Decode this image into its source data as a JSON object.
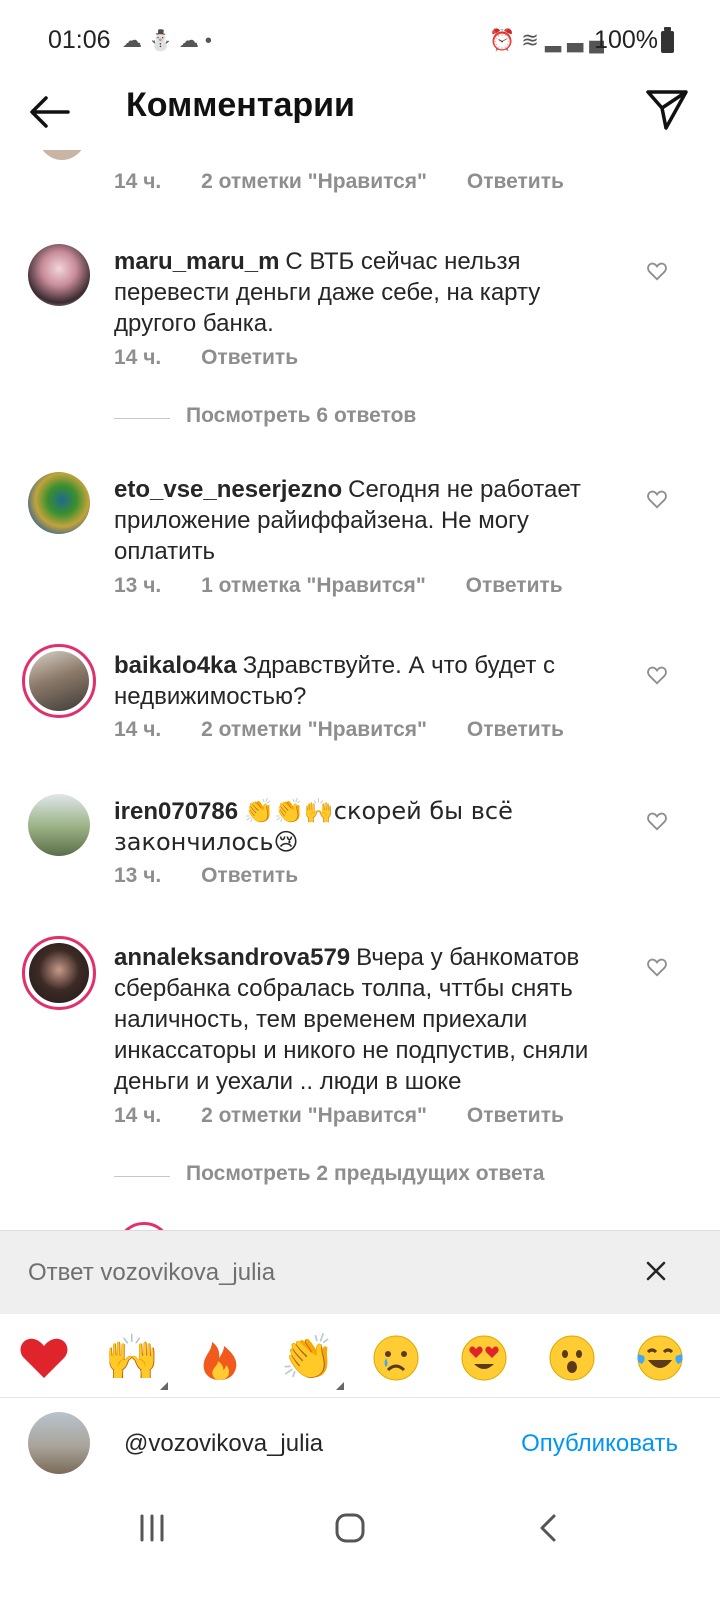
{
  "status_bar": {
    "time": "01:06",
    "left_icons": [
      "cloud-icon",
      "figure-icon",
      "cloud-icon",
      "dot-icon"
    ],
    "right_icons": [
      "alarm-icon",
      "wifi-icon",
      "signal-icon"
    ],
    "battery": "100%"
  },
  "header": {
    "title": "Комментарии"
  },
  "partial_comment": {
    "meta": [
      "14 ч.",
      "2 отметки \"Нравится\"",
      "Ответить"
    ]
  },
  "comments": [
    {
      "user": "maru_maru_m",
      "text": "С ВТБ сейчас нельзя перевести деньги даже себе, на карту другого банка.",
      "time": "14 ч.",
      "likes": "",
      "reply": "Ответить"
    },
    {
      "user": "eto_vse_neserjezno",
      "text": "Сегодня не работает приложение райиффайзена. Не могу оплатить",
      "time": "13 ч.",
      "likes": "1 отметка \"Нравится\"",
      "reply": "Ответить"
    },
    {
      "user": "baikalo4ka",
      "text": "Здравствуйте. А что будет с недвижимостью?",
      "time": "14 ч.",
      "likes": "2 отметки \"Нравится\"",
      "reply": "Ответить"
    },
    {
      "user": "iren070786",
      "text": "👏👏🙌скорей бы всё закончилось😢",
      "time": "13 ч.",
      "likes": "",
      "reply": "Ответить"
    },
    {
      "user": "annaleksandrova579",
      "text": "Вчера у банкоматов сбербанка собралась толпа, чттбы снять наличность, тем временем приехали инкассаторы и никого не подпустив, сняли деньги и уехали .. люди в шоке",
      "time": "14 ч.",
      "likes": "2 отметки \"Нравится\"",
      "reply": "Ответить"
    }
  ],
  "view_replies": [
    "Посмотреть 6 ответов",
    "Посмотреть 2 предыдущих ответа"
  ],
  "reply_bar": {
    "label": "Ответ vozovikova_julia"
  },
  "emoji_bar": [
    "red-heart",
    "raising-hands",
    "fire",
    "clapping-hands",
    "crying-face",
    "heart-eyes-face",
    "surprised-face",
    "tears-of-joy-face"
  ],
  "input": {
    "value": "@vozovikova_julia",
    "publish": "Опубликовать"
  },
  "colors": {
    "accent_blue": "#0095f6",
    "story_ring": "#e1306c",
    "secondary_text": "#8e8e8e"
  }
}
